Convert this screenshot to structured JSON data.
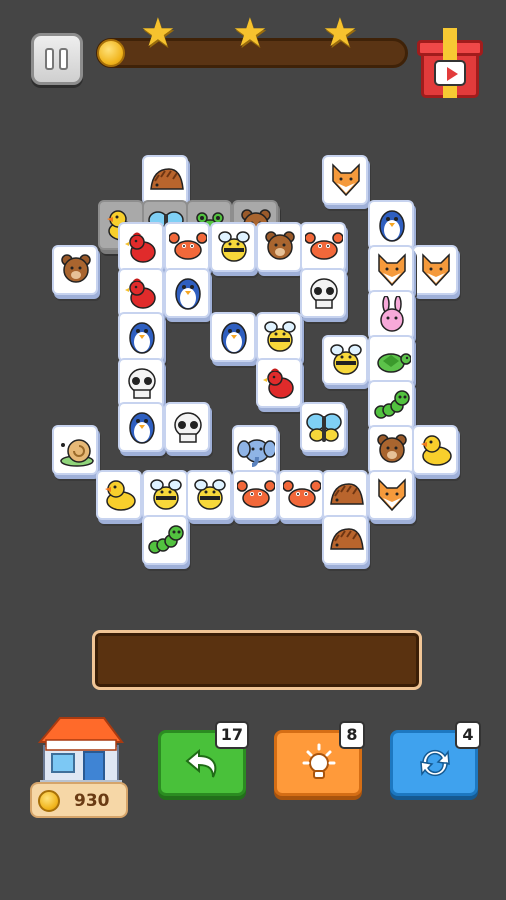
{
  "header": {
    "pause_icon": "pause-icon",
    "stars_earned": 3,
    "level_progress": 0.0,
    "reward_icon": "gift-video-icon"
  },
  "board": {
    "tiles": [
      {
        "animal": "hedgehog",
        "state": "top"
      },
      {
        "animal": "fox",
        "state": "top"
      },
      {
        "animal": "duck",
        "state": "dim"
      },
      {
        "animal": "butterfly",
        "state": "dim"
      },
      {
        "animal": "frog",
        "state": "dim"
      },
      {
        "animal": "bear",
        "state": "dim"
      },
      {
        "animal": "penguin",
        "state": "top"
      },
      {
        "animal": "bear",
        "state": "top"
      },
      {
        "animal": "rooster",
        "state": "top"
      },
      {
        "animal": "crab",
        "state": "top"
      },
      {
        "animal": "bee",
        "state": "top"
      },
      {
        "animal": "bear",
        "state": "top"
      },
      {
        "animal": "crab",
        "state": "top"
      },
      {
        "animal": "fox",
        "state": "top"
      },
      {
        "animal": "fox",
        "state": "top"
      },
      {
        "animal": "rooster",
        "state": "top"
      },
      {
        "animal": "penguin",
        "state": "top"
      },
      {
        "animal": "skull",
        "state": "top"
      },
      {
        "animal": "rabbit",
        "state": "top"
      },
      {
        "animal": "penguin",
        "state": "top"
      },
      {
        "animal": "penguin",
        "state": "top"
      },
      {
        "animal": "bee",
        "state": "top"
      },
      {
        "animal": "bee",
        "state": "top"
      },
      {
        "animal": "turtle",
        "state": "top"
      },
      {
        "animal": "skull",
        "state": "top"
      },
      {
        "animal": "rooster",
        "state": "top"
      },
      {
        "animal": "caterpillar",
        "state": "top"
      },
      {
        "animal": "snail",
        "state": "top"
      },
      {
        "animal": "penguin",
        "state": "top"
      },
      {
        "animal": "skull",
        "state": "top"
      },
      {
        "animal": "elephant",
        "state": "top"
      },
      {
        "animal": "butterfly",
        "state": "top"
      },
      {
        "animal": "bear",
        "state": "top"
      },
      {
        "animal": "duck",
        "state": "top"
      },
      {
        "animal": "duck",
        "state": "top"
      },
      {
        "animal": "bee",
        "state": "top"
      },
      {
        "animal": "bee",
        "state": "top"
      },
      {
        "animal": "crab",
        "state": "top"
      },
      {
        "animal": "crab",
        "state": "top"
      },
      {
        "animal": "hedgehog",
        "state": "top"
      },
      {
        "animal": "fox",
        "state": "top"
      },
      {
        "animal": "caterpillar",
        "state": "top"
      },
      {
        "animal": "hedgehog",
        "state": "top"
      }
    ]
  },
  "tray": {
    "slots_filled": 0
  },
  "bottom": {
    "shop_icon": "shop-house-icon",
    "coins": "930",
    "undo": {
      "icon": "undo-arrow-icon",
      "count": "17"
    },
    "hint": {
      "icon": "lightbulb-icon",
      "count": "8"
    },
    "shuffle": {
      "icon": "shuffle-icon",
      "count": "4"
    }
  },
  "colors": {
    "background": "#454545",
    "undo": "#49c13a",
    "hint": "#ff9a3a",
    "shuffle": "#3fa2ee",
    "tray": "#5a3210"
  }
}
